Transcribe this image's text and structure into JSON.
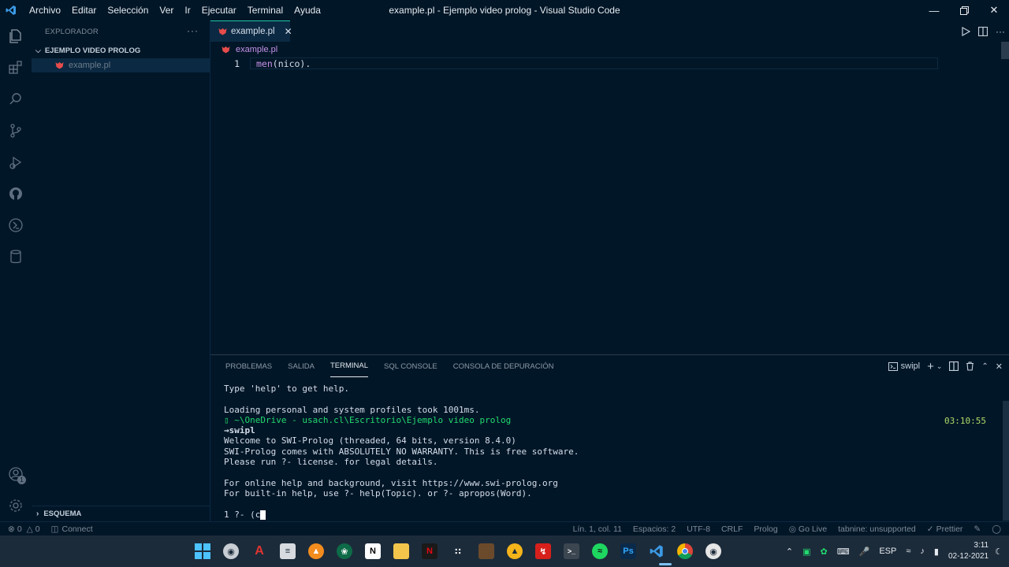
{
  "window": {
    "title": "example.pl - Ejemplo video prolog - Visual Studio Code",
    "menu": [
      "Archivo",
      "Editar",
      "Selección",
      "Ver",
      "Ir",
      "Ejecutar",
      "Terminal",
      "Ayuda"
    ]
  },
  "sidebar": {
    "header": "EXPLORADOR",
    "folder": "EJEMPLO VIDEO PROLOG",
    "files": [
      "example.pl"
    ],
    "outline": "ESQUEMA"
  },
  "activitybar": {
    "icons": [
      "files-icon",
      "extensions-icon",
      "search-icon",
      "source-control-icon",
      "run-debug-icon",
      "github-icon",
      "remote-icon",
      "database-icon"
    ],
    "accounts_badge": "1"
  },
  "editor": {
    "tab_label": "example.pl",
    "breadcrumb": "example.pl",
    "lines": [
      {
        "num": "1",
        "head": "men",
        "open": "(",
        "arg": "nico",
        "close": ")",
        "end": "."
      }
    ]
  },
  "panel": {
    "tabs": [
      "PROBLEMAS",
      "SALIDA",
      "TERMINAL",
      "SQL CONSOLE",
      "CONSOLA DE DEPURACIÓN"
    ],
    "active_tab": "TERMINAL",
    "terminal_name": "swipl",
    "time": "03:10:55",
    "lines": [
      "Type 'help' to get help.",
      "",
      "Loading personal and system profiles took 1001ms.",
      "▯ ~\\OneDrive - usach.cl\\Escritorio\\Ejemplo video prolog",
      "→swipl",
      "Welcome to SWI-Prolog (threaded, 64 bits, version 8.4.0)",
      "SWI-Prolog comes with ABSOLUTELY NO WARRANTY. This is free software.",
      "Please run ?- license. for legal details.",
      "",
      "For online help and background, visit https://www.swi-prolog.org",
      "For built-in help, use ?- help(Topic). or ?- apropos(Word).",
      "",
      "1 ?- (c"
    ]
  },
  "statusbar": {
    "errors": "0",
    "warnings": "0",
    "connect": "Connect",
    "position": "Lín. 1, col. 11",
    "spaces": "Espacios: 2",
    "encoding": "UTF-8",
    "eol": "CRLF",
    "language": "Prolog",
    "go_live": "Go Live",
    "tabnine": "tabnine: unsupported",
    "prettier": "Prettier"
  },
  "taskbar": {
    "language": "ESP",
    "time": "3:11",
    "date": "02-12-2021"
  },
  "colors": {
    "background": "#011627",
    "accent": "#21c7a8",
    "prolog_icon": "#e74c4c"
  }
}
